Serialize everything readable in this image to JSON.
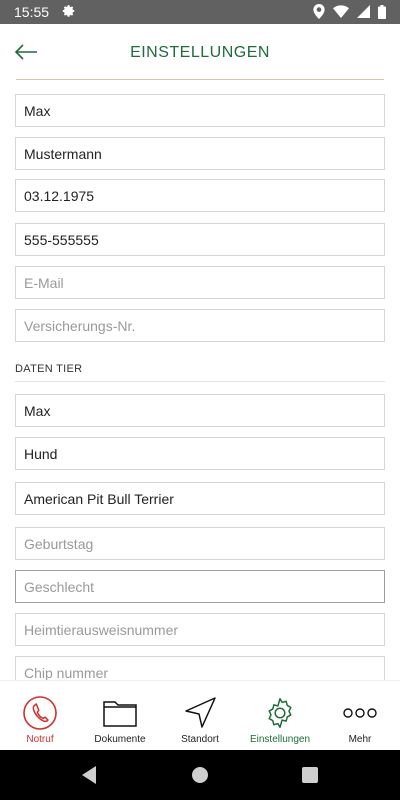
{
  "status_bar": {
    "time": "15:55",
    "icons": [
      "settings-icon",
      "location-icon",
      "wifi-icon",
      "signal-icon",
      "battery-icon"
    ]
  },
  "header": {
    "title": "EINSTELLUNGEN",
    "back_icon": "arrow-left-icon",
    "accent_color": "#1f6b3a"
  },
  "person": {
    "first_name": "Max",
    "last_name": "Mustermann",
    "birthdate": "03.12.1975",
    "phone": "555-555555",
    "email_placeholder": "E-Mail",
    "insurance_placeholder": "Versicherungs-Nr."
  },
  "animal": {
    "section_title": "DATEN TIER",
    "name": "Max",
    "species": "Hund",
    "breed": "American Pit Bull Terrier",
    "birthday_placeholder": "Geburtstag",
    "gender_placeholder": "Geschlecht",
    "pet_passport_placeholder": "Heimtierausweisnummer",
    "chip_placeholder": "Chip nummer"
  },
  "bottom_nav": {
    "items": [
      {
        "label": "Notruf",
        "icon": "phone-icon",
        "color": "#d32f2f"
      },
      {
        "label": "Dokumente",
        "icon": "folder-icon"
      },
      {
        "label": "Standort",
        "icon": "navigation-icon"
      },
      {
        "label": "Einstellungen",
        "icon": "gear-icon",
        "active": true
      },
      {
        "label": "Mehr",
        "icon": "more-icon"
      }
    ]
  },
  "system_nav": {
    "icons": [
      "back-triangle-icon",
      "home-circle-icon",
      "recents-square-icon"
    ]
  }
}
